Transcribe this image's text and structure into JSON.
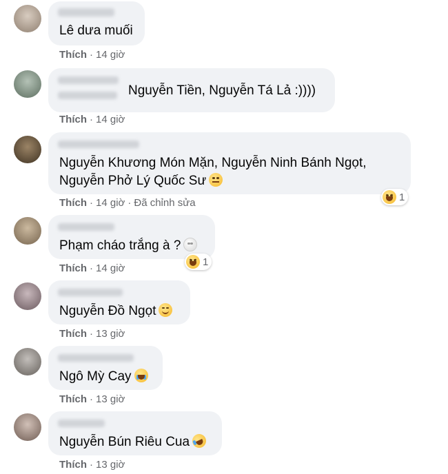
{
  "comments": [
    {
      "text_lines": [
        "Lê dưa muối"
      ],
      "like_label": "Thích",
      "time": "14 giờ",
      "avatar_color": "#b7a89a"
    },
    {
      "text_lines": [
        "Nguyễn Tiền, Nguyễn Tá Lả :))))"
      ],
      "like_label": "Thích",
      "time": "14 giờ",
      "avatar_color": "#8a9b8c"
    },
    {
      "text_lines": [
        "Nguyễn Khương Món Mặn, Nguyễn Ninh Bánh Ngọt,",
        "Nguyễn Phở Lý Quốc Sư"
      ],
      "line2_emoji": "thinking-face-emoji",
      "like_label": "Thích",
      "time": "14 giờ",
      "edited_label": "Đã chỉnh sửa",
      "reaction": {
        "emoji": "laughing-emoji",
        "count": "1"
      },
      "avatar_color": "#6d5a45"
    },
    {
      "text_lines": [
        "Phạm cháo trắng à ?"
      ],
      "emoji": "white-face-emoji",
      "like_label": "Thích",
      "time": "14 giờ",
      "reaction": {
        "emoji": "laughing-emoji",
        "count": "1"
      },
      "avatar_color": "#a08c74"
    },
    {
      "text_lines": [
        "Nguyễn Đồ Ngọt"
      ],
      "emoji": "smiling-face-emoji",
      "like_label": "Thích",
      "time": "13 giờ",
      "avatar_color": "#9a8a8e"
    },
    {
      "text_lines": [
        "Ngô Mỳ Cay"
      ],
      "emoji": "crying-face-emoji",
      "like_label": "Thích",
      "time": "13 giờ",
      "avatar_color": "#8e8a86"
    },
    {
      "text_lines": [
        "Nguyễn Bún Riêu Cua"
      ],
      "emoji": "rolling-laughing-emoji",
      "like_label": "Thích",
      "time": "13 giờ",
      "avatar_color": "#a6948c"
    }
  ],
  "colors": {
    "bubble_bg": "#f0f2f5",
    "meta_text": "#65676b",
    "body_text": "#050505"
  }
}
